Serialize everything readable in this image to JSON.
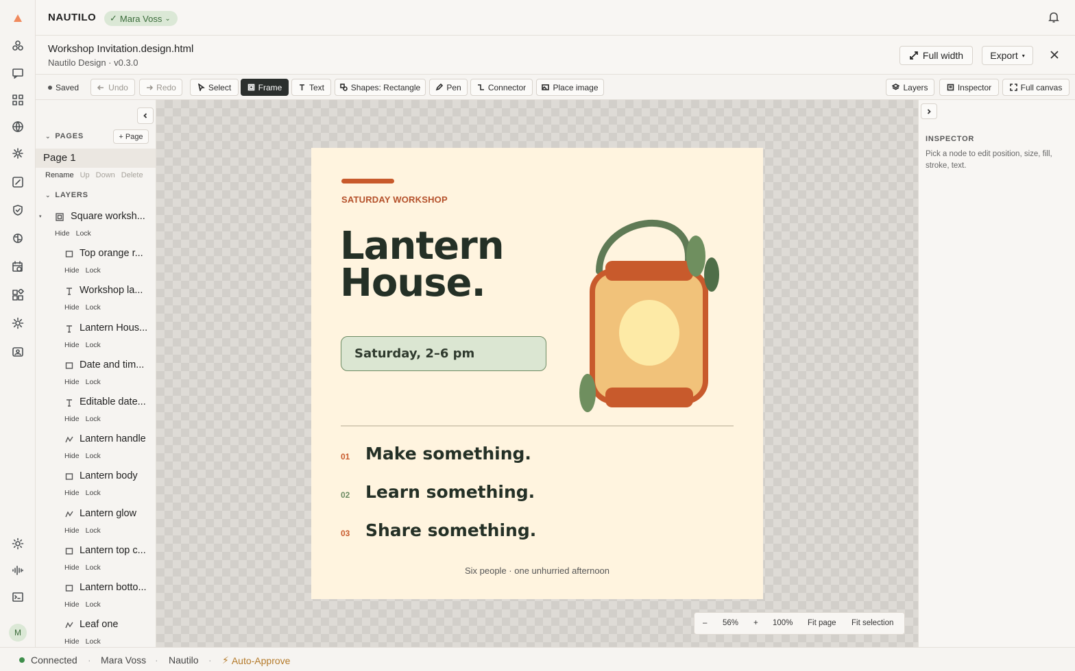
{
  "header": {
    "brand": "NAUTILO",
    "user_chip": "Mara Voss"
  },
  "document": {
    "title": "Workshop Invitation.design.html",
    "subtitle": "Nautilo Design · v0.3.0",
    "full_width_label": "Full width",
    "export_label": "Export"
  },
  "toolbar": {
    "saved": "Saved",
    "undo": "Undo",
    "redo": "Redo",
    "select": "Select",
    "frame": "Frame",
    "text": "Text",
    "shapes": "Shapes: Rectangle",
    "pen": "Pen",
    "connector": "Connector",
    "place_image": "Place image",
    "layers": "Layers",
    "inspector": "Inspector",
    "full_canvas": "Full canvas"
  },
  "sidebar": {
    "pages_heading": "PAGES",
    "add_page": "Page",
    "current_page": "Page 1",
    "page_actions": [
      "Rename",
      "Up",
      "Down",
      "Delete"
    ],
    "layers_heading": "LAYERS",
    "hide_label": "Hide",
    "lock_label": "Lock",
    "layers": [
      {
        "name": "Square worksh...",
        "icon": "frame-icon"
      },
      {
        "name": "Top orange r...",
        "icon": "rect-icon"
      },
      {
        "name": "Workshop la...",
        "icon": "text-icon"
      },
      {
        "name": "Lantern Hous...",
        "icon": "text-icon"
      },
      {
        "name": "Date and tim...",
        "icon": "rect-icon"
      },
      {
        "name": "Editable date...",
        "icon": "text-icon"
      },
      {
        "name": "Lantern handle",
        "icon": "path-icon"
      },
      {
        "name": "Lantern body",
        "icon": "rect-icon"
      },
      {
        "name": "Lantern glow",
        "icon": "path-icon"
      },
      {
        "name": "Lantern top c...",
        "icon": "rect-icon"
      },
      {
        "name": "Lantern botto...",
        "icon": "rect-icon"
      },
      {
        "name": "Leaf one",
        "icon": "path-icon"
      }
    ]
  },
  "artboard": {
    "eyebrow": "SATURDAY WORKSHOP",
    "headline_line1": "Lantern",
    "headline_line2": "House.",
    "date": "Saturday, 2–6 pm",
    "items": [
      {
        "num": "01",
        "text": "Make something.",
        "color": "#c85a2c"
      },
      {
        "num": "02",
        "text": "Learn something.",
        "color": "#6c8a62"
      },
      {
        "num": "03",
        "text": "Share something.",
        "color": "#c85a2c"
      }
    ],
    "footer": "Six people · one unhurried afternoon",
    "colors": {
      "background": "#fff4df",
      "accent": "#c85a2c",
      "ink": "#243026",
      "green": "#6c8a62"
    }
  },
  "zoom": {
    "minus": "–",
    "level": "56%",
    "plus": "+",
    "hundred": "100%",
    "fit_page": "Fit page",
    "fit_selection": "Fit selection"
  },
  "inspector": {
    "heading": "INSPECTOR",
    "hint": "Pick a node to edit position, size, fill, stroke, text."
  },
  "status": {
    "connection": "Connected",
    "user": "Mara Voss",
    "app": "Nautilo",
    "mode": "Auto-Approve"
  }
}
